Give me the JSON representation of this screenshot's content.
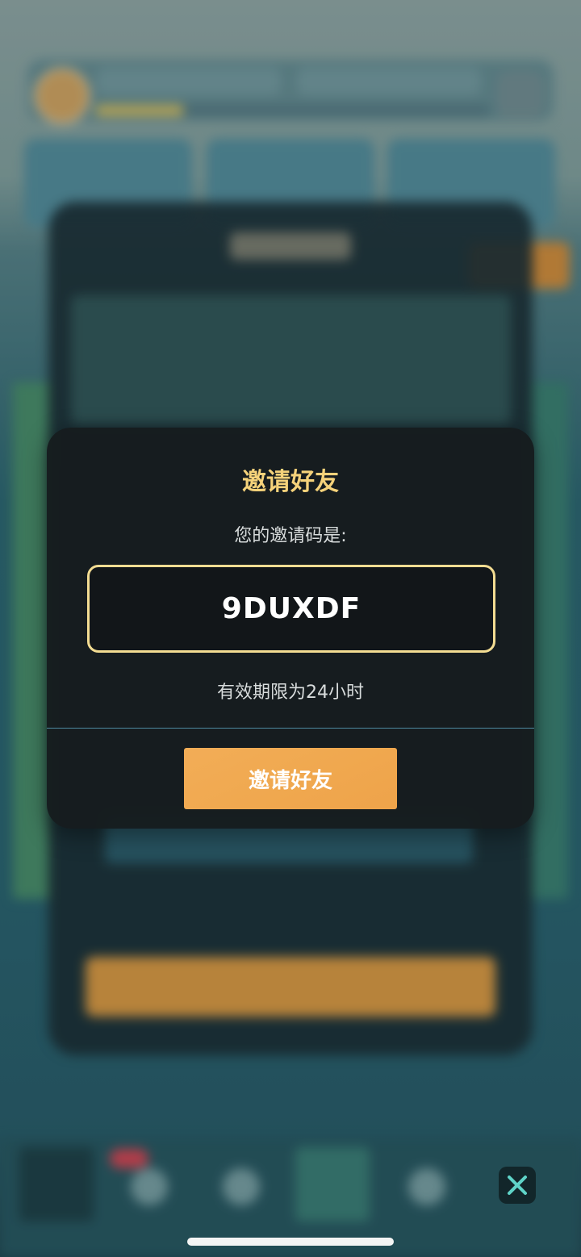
{
  "dialog": {
    "title": "邀请好友",
    "code_label": "您的邀请码是:",
    "code": "9DUXDF",
    "validity": "有效期限为24小时",
    "invite_button": "邀请好友"
  },
  "colors": {
    "accent": "#f0a84f",
    "title": "#f5d27a",
    "code_border": "#f3dc92",
    "close": "#5fd4c8"
  },
  "icons": {
    "close": "close-icon"
  }
}
